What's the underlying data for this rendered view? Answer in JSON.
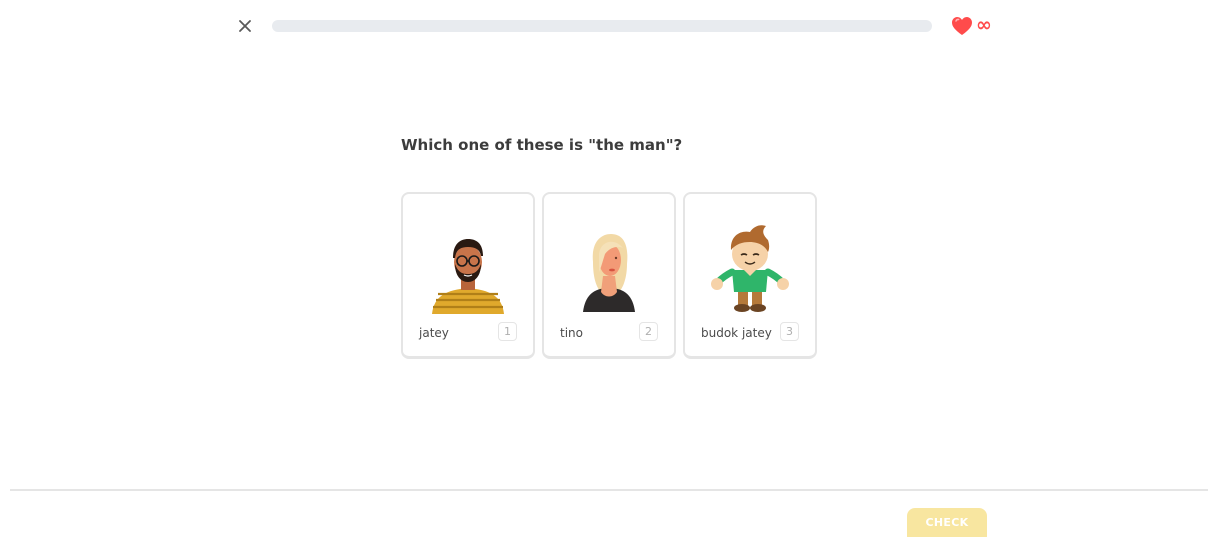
{
  "header": {
    "close_icon": "close-icon",
    "progress": 0,
    "heart_icon": "heart-icon",
    "hearts_label": "∞"
  },
  "question": {
    "text": "Which one of these is \"the man\"?"
  },
  "choices": [
    {
      "label": "jatey",
      "key": "1",
      "icon": "man-illustration"
    },
    {
      "label": "tino",
      "key": "2",
      "icon": "woman-illustration"
    },
    {
      "label": "budok jatey",
      "key": "3",
      "icon": "boy-illustration"
    }
  ],
  "footer": {
    "check_label": "CHECK"
  },
  "colors": {
    "heart": "#ff4b4b",
    "progress_track": "#e8ebef",
    "check_disabled": "#f8e6a0",
    "border": "#e5e5e5"
  }
}
